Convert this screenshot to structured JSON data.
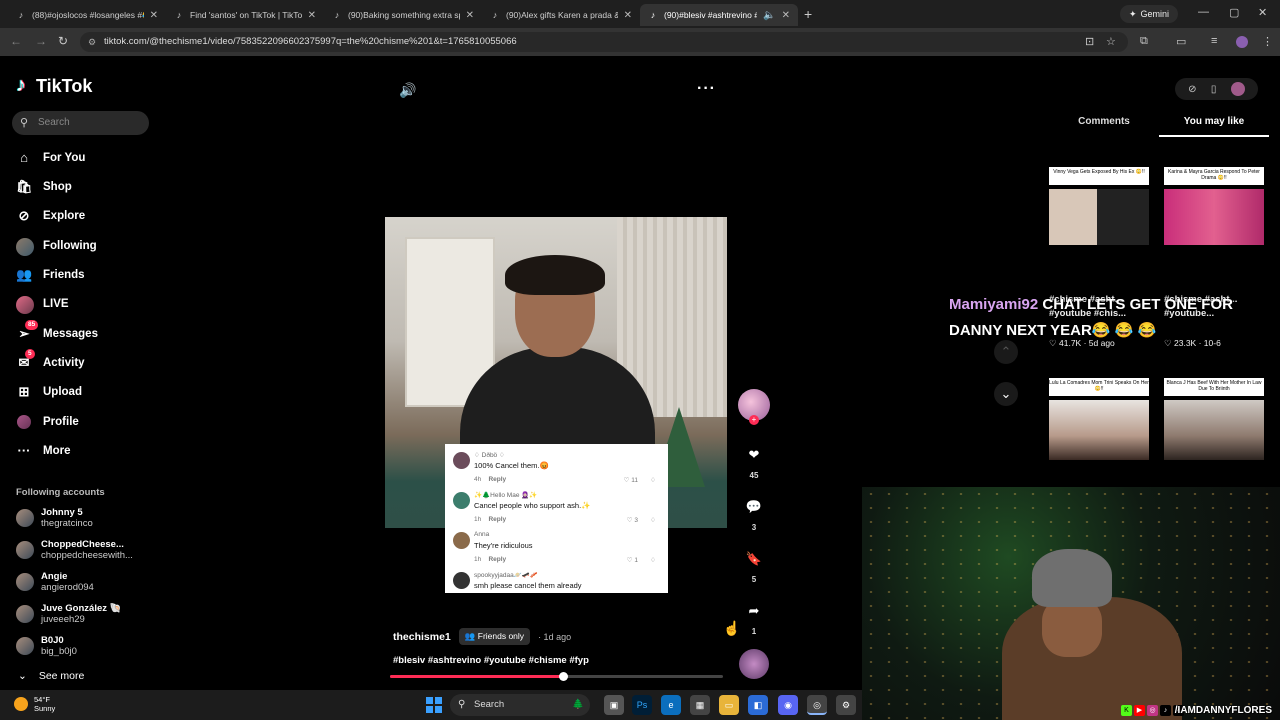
{
  "browser": {
    "tabs": [
      {
        "label": "(88)#ojoslocos #losangeles #😂"
      },
      {
        "label": "Find 'santos' on TikTok | TikTok"
      },
      {
        "label": "(90)Baking something extra spe"
      },
      {
        "label": "(90)Alex gifts Karen a prada &"
      },
      {
        "label": "(90)#blesiv #ashtrevino #yo"
      }
    ],
    "gemini_label": "Gemini",
    "url": "tiktok.com/@thechisme1/video/7583522096602375997q=the%20chisme%201&t=1765810055066"
  },
  "sidebar": {
    "logo": "TikTok",
    "search_placeholder": "Search",
    "nav": [
      {
        "label": "For You",
        "icon": "home-icon"
      },
      {
        "label": "Shop",
        "icon": "shop-icon"
      },
      {
        "label": "Explore",
        "icon": "compass-icon"
      },
      {
        "label": "Following",
        "icon": "following-avatar"
      },
      {
        "label": "Friends",
        "icon": "friends-icon"
      },
      {
        "label": "LIVE",
        "icon": "live-icon"
      },
      {
        "label": "Messages",
        "icon": "messages-icon",
        "badge": "85"
      },
      {
        "label": "Activity",
        "icon": "activity-icon",
        "badge": "5"
      },
      {
        "label": "Upload",
        "icon": "upload-icon"
      },
      {
        "label": "Profile",
        "icon": "profile-avatar"
      },
      {
        "label": "More",
        "icon": "more-icon"
      }
    ],
    "following_header": "Following accounts",
    "following": [
      {
        "name": "Johnny 5",
        "handle": "thegratcinco"
      },
      {
        "name": "ChoppedCheese...",
        "handle": "choppedcheesewith..."
      },
      {
        "name": "Angie",
        "handle": "angierod094"
      },
      {
        "name": "Juve González 🐚",
        "handle": "juveeeh29"
      },
      {
        "name": "B0J0",
        "handle": "big_b0j0"
      }
    ],
    "see_more": "See more"
  },
  "video": {
    "comments": [
      {
        "name": "♢ Dðbö ♢",
        "text": "100% Cancel them.😡",
        "meta": "4h",
        "reply": "Reply",
        "likes": "11"
      },
      {
        "name": "✨🌲Hello Mae 🧕🏻✨",
        "text": "Cancel people who support ash.✨",
        "meta": "1h",
        "reply": "Reply",
        "likes": "3"
      },
      {
        "name": "Anna",
        "text": "They're ridiculous",
        "meta": "1h",
        "reply": "Reply",
        "likes": "1"
      },
      {
        "name": "spookyyjadaa🪐🛹🥓",
        "text": "smh please cancel them already",
        "meta": "",
        "reply": "",
        "likes": ""
      }
    ],
    "author": "thechisme1",
    "privacy": "Friends only",
    "ago": "· 1d ago",
    "hashtags": "#blesiv #ashtrevino #youtube #chisme #fyp",
    "progress": 0.52,
    "likes": "45",
    "comments_count": "3",
    "saves": "5",
    "shares": "1"
  },
  "right": {
    "tabs": [
      "Comments",
      "You may like"
    ],
    "cards": [
      {
        "caption": "Vinny Vega Gets Exposed By His Ex 😳!!",
        "title": "#chisme #asht...",
        "subtitle": "#youtube #chis...",
        "likes": "41.7K",
        "date": "5d ago"
      },
      {
        "caption": "Karina & Mayra Garcia Respond To Peter Drama 😳!!",
        "title": "#chisme #asht...",
        "subtitle": "#youtube...",
        "likes": "23.3K",
        "date": "10-6"
      },
      {
        "caption": "Lulu La Comadres Mom Trini Speaks On Her 😳!!",
        "title": "",
        "subtitle": "",
        "likes": "",
        "date": ""
      },
      {
        "caption": "Blanca J Has Beef With Her Mother In Law Due To Briinth",
        "title": "",
        "subtitle": "",
        "likes": "",
        "date": ""
      }
    ]
  },
  "stream": {
    "chat_user": "Mamiyami92",
    "chat_text": "CHAT LETS GET ONE FOR DANNY NEXT YEAR😂 😂 😂",
    "handle": "/IAMDANNYFLORES"
  },
  "taskbar": {
    "temp": "54°F",
    "condition": "Sunny",
    "search": "Search"
  }
}
